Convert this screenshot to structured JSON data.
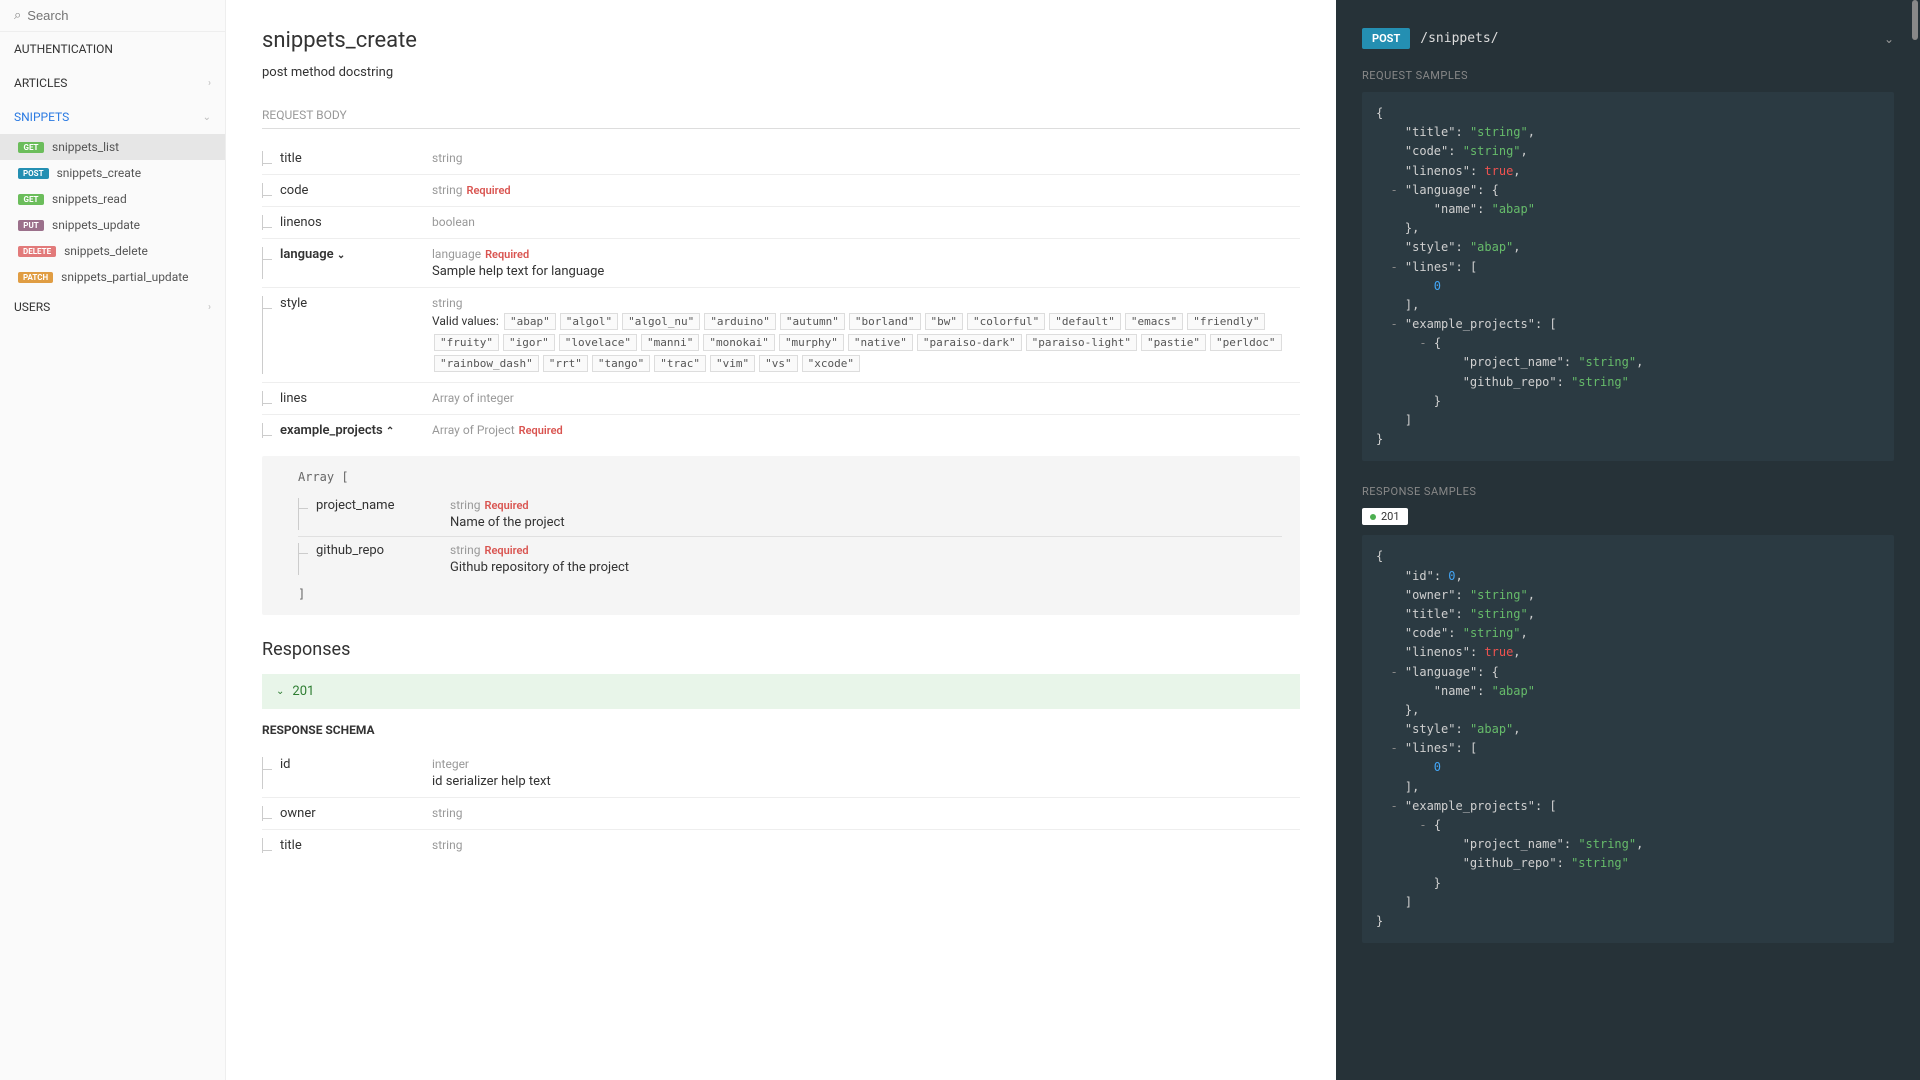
{
  "search": {
    "placeholder": "Search"
  },
  "nav": {
    "sections": [
      "AUTHENTICATION",
      "ARTICLES",
      "SNIPPETS",
      "USERS"
    ],
    "snippets_items": [
      {
        "method": "GET",
        "label": "snippets_list"
      },
      {
        "method": "POST",
        "label": "snippets_create"
      },
      {
        "method": "GET",
        "label": "snippets_read"
      },
      {
        "method": "PUT",
        "label": "snippets_update"
      },
      {
        "method": "DELETE",
        "label": "snippets_delete"
      },
      {
        "method": "PATCH",
        "label": "snippets_partial_update"
      }
    ]
  },
  "page": {
    "title": "snippets_create",
    "subtitle": "post method docstring",
    "request_body_label": "REQUEST BODY",
    "responses_label": "Responses",
    "response_status": "201",
    "response_schema_label": "RESPONSE SCHEMA"
  },
  "fields": {
    "title": {
      "name": "title",
      "type": "string"
    },
    "code": {
      "name": "code",
      "type": "string",
      "required": "Required"
    },
    "linenos": {
      "name": "linenos",
      "type": "boolean"
    },
    "language": {
      "name": "language",
      "type": "language",
      "required": "Required",
      "desc": "Sample help text for language"
    },
    "style": {
      "name": "style",
      "type": "string",
      "valid_label": "Valid values:",
      "enums": [
        "\"abap\"",
        "\"algol\"",
        "\"algol_nu\"",
        "\"arduino\"",
        "\"autumn\"",
        "\"borland\"",
        "\"bw\"",
        "\"colorful\"",
        "\"default\"",
        "\"emacs\"",
        "\"friendly\"",
        "\"fruity\"",
        "\"igor\"",
        "\"lovelace\"",
        "\"manni\"",
        "\"monokai\"",
        "\"murphy\"",
        "\"native\"",
        "\"paraiso-dark\"",
        "\"paraiso-light\"",
        "\"pastie\"",
        "\"perldoc\"",
        "\"rainbow_dash\"",
        "\"rrt\"",
        "\"tango\"",
        "\"trac\"",
        "\"vim\"",
        "\"vs\"",
        "\"xcode\""
      ]
    },
    "lines": {
      "name": "lines",
      "type_prefix": "Array of ",
      "type": "integer"
    },
    "example_projects": {
      "name": "example_projects",
      "type_prefix": "Array of ",
      "type": "Project",
      "required": "Required"
    },
    "nested": {
      "arr_open": "Array [",
      "arr_close": "]",
      "project_name": {
        "name": "project_name",
        "type": "string",
        "required": "Required",
        "desc": "Name of the project"
      },
      "github_repo": {
        "name": "github_repo",
        "type": "string",
        "required": "Required",
        "desc": "Github repository of the project"
      }
    }
  },
  "response_fields": {
    "id": {
      "name": "id",
      "type": "integer",
      "desc": "id serializer help text"
    },
    "owner": {
      "name": "owner",
      "type": "string"
    },
    "title": {
      "name": "title",
      "type": "string"
    }
  },
  "right": {
    "method": "POST",
    "path": "/snippets/",
    "request_samples_label": "REQUEST SAMPLES",
    "response_samples_label": "RESPONSE SAMPLES",
    "status_chip": "201"
  },
  "sample_request": {
    "title_k": "\"title\"",
    "title_v": "\"string\"",
    "code_k": "\"code\"",
    "code_v": "\"string\"",
    "linenos_k": "\"linenos\"",
    "linenos_v": "true",
    "language_k": "\"language\"",
    "name_k": "\"name\"",
    "name_v": "\"abap\"",
    "style_k": "\"style\"",
    "style_v": "\"abap\"",
    "lines_k": "\"lines\"",
    "lines_v": "0",
    "ex_k": "\"example_projects\"",
    "pn_k": "\"project_name\"",
    "pn_v": "\"string\"",
    "gr_k": "\"github_repo\"",
    "gr_v": "\"string\""
  },
  "sample_response": {
    "id_k": "\"id\"",
    "id_v": "0",
    "owner_k": "\"owner\"",
    "owner_v": "\"string\""
  }
}
